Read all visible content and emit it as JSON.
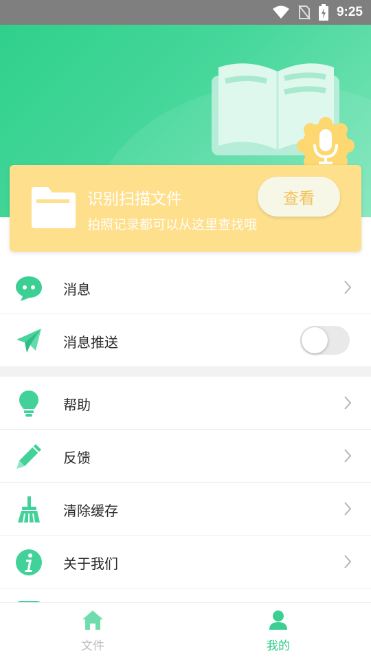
{
  "status_bar": {
    "time": "9:25"
  },
  "card": {
    "title": "识别扫描文件",
    "subtitle": "拍照记录都可以从这里查找哦",
    "view_button": "查看"
  },
  "menu": [
    {
      "label": "消息",
      "icon": "message-bubble-icon"
    },
    {
      "label": "消息推送",
      "icon": "paper-plane-icon",
      "toggle": false
    },
    {
      "label": "帮助",
      "icon": "lightbulb-icon"
    },
    {
      "label": "反馈",
      "icon": "pencil-icon"
    },
    {
      "label": "清除缓存",
      "icon": "broom-icon"
    },
    {
      "label": "关于我们",
      "icon": "info-icon"
    }
  ],
  "bottom_nav": {
    "files": "文件",
    "mine": "我的",
    "active": "mine"
  },
  "colors": {
    "accent": "#2fcc8a",
    "card": "#fedf8c",
    "button_text": "#f5c25a"
  }
}
